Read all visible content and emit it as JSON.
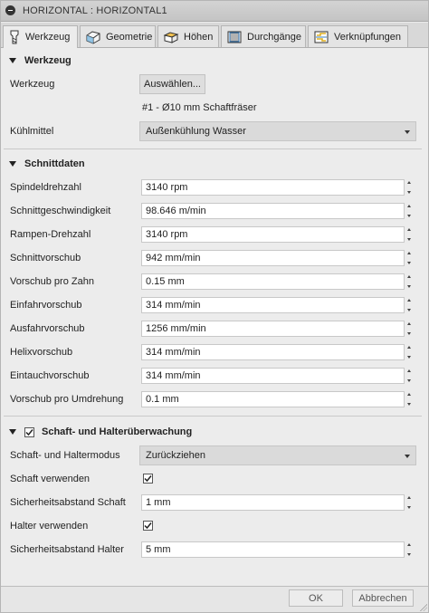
{
  "window": {
    "title": "HORIZONTAL : HORIZONTAL1"
  },
  "tabs": [
    {
      "label": "Werkzeug",
      "icon": "tool-icon",
      "active": true
    },
    {
      "label": "Geometrie",
      "icon": "geometry-icon",
      "active": false
    },
    {
      "label": "Höhen",
      "icon": "heights-icon",
      "active": false
    },
    {
      "label": "Durchgänge",
      "icon": "passes-icon",
      "active": false
    },
    {
      "label": "Verknüpfungen",
      "icon": "linking-icon",
      "active": false
    }
  ],
  "werkzeug": {
    "header": "Werkzeug",
    "tool_label": "Werkzeug",
    "select_button": "Auswählen...",
    "tool_name": "#1 - Ø10 mm Schaftfräser",
    "coolant_label": "Kühlmittel",
    "coolant_value": "Außenkühlung Wasser"
  },
  "schnittdaten": {
    "header": "Schnittdaten",
    "fields": [
      {
        "label": "Spindeldrehzahl",
        "value": "3140 rpm"
      },
      {
        "label": "Schnittgeschwindigkeit",
        "value": "98.646 m/min"
      },
      {
        "label": "Rampen-Drehzahl",
        "value": "3140 rpm"
      },
      {
        "label": "Schnittvorschub",
        "value": "942 mm/min"
      },
      {
        "label": "Vorschub pro Zahn",
        "value": "0.15 mm"
      },
      {
        "label": "Einfahrvorschub",
        "value": "314 mm/min"
      },
      {
        "label": "Ausfahrvorschub",
        "value": "1256 mm/min"
      },
      {
        "label": "Helixvorschub",
        "value": "314 mm/min"
      },
      {
        "label": "Eintauchvorschub",
        "value": "314 mm/min"
      },
      {
        "label": "Vorschub pro Umdrehung",
        "value": "0.1 mm"
      }
    ]
  },
  "schaft": {
    "header": "Schaft- und Halterüberwachung",
    "enabled": true,
    "mode_label": "Schaft- und Haltermodus",
    "mode_value": "Zurückziehen",
    "use_shaft_label": "Schaft verwenden",
    "use_shaft": true,
    "shaft_clearance_label": "Sicherheitsabstand Schaft",
    "shaft_clearance_value": "1 mm",
    "use_holder_label": "Halter verwenden",
    "use_holder": true,
    "holder_clearance_label": "Sicherheitsabstand Halter",
    "holder_clearance_value": "5 mm"
  },
  "footer": {
    "ok": "OK",
    "cancel": "Abbrechen"
  }
}
